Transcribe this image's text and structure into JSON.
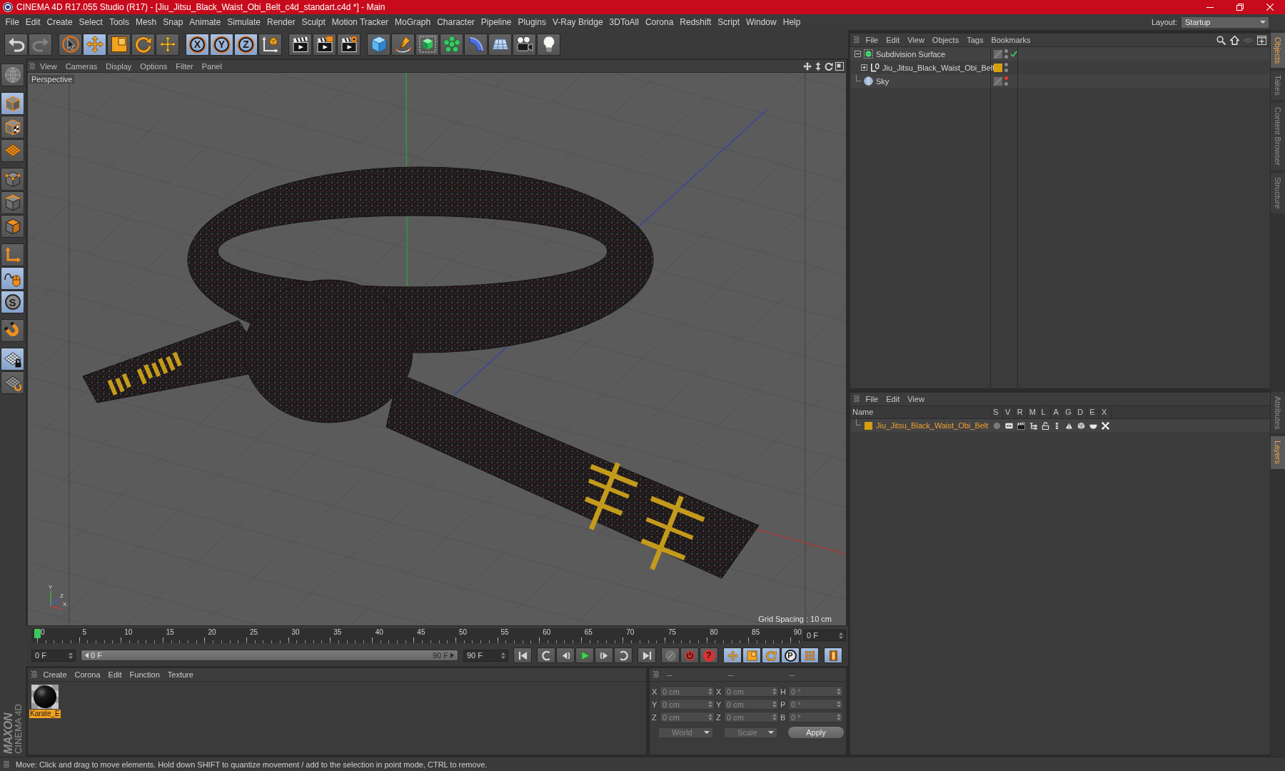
{
  "window": {
    "title": "CINEMA 4D R17.055 Studio (R17) - [Jiu_Jitsu_Black_Waist_Obi_Belt_c4d_standart.c4d *] - Main",
    "controls": [
      {
        "kind": "minimize"
      },
      {
        "kind": "restore"
      },
      {
        "kind": "close"
      }
    ]
  },
  "menu_bar": {
    "items": [
      "File",
      "Edit",
      "Create",
      "Select",
      "Tools",
      "Mesh",
      "Snap",
      "Animate",
      "Simulate",
      "Render",
      "Sculpt",
      "Motion Tracker",
      "MoGraph",
      "Character",
      "Pipeline",
      "Plugins",
      "V-Ray Bridge",
      "3DToAll",
      "Corona",
      "Redshift",
      "Script",
      "Window",
      "Help"
    ],
    "layout_label": "Layout:",
    "layout_value": "Startup"
  },
  "toolbar": {
    "groups": [
      [
        {
          "kind": "undo",
          "selected": false,
          "disabled": false
        },
        {
          "kind": "redo",
          "selected": false,
          "disabled": true
        }
      ],
      [
        {
          "kind": "live_select",
          "selected": false,
          "disabled": false
        },
        {
          "kind": "move",
          "selected": true,
          "disabled": false
        },
        {
          "kind": "scale",
          "selected": false,
          "disabled": false
        },
        {
          "kind": "rotate",
          "selected": false,
          "disabled": false
        },
        {
          "kind": "recent",
          "selected": false,
          "disabled": false
        }
      ],
      [
        {
          "kind": "axis_lock",
          "label": "X",
          "selected": true,
          "disabled": false
        },
        {
          "kind": "axis_lock",
          "label": "Y",
          "selected": true,
          "disabled": false
        },
        {
          "kind": "axis_lock",
          "label": "Z",
          "selected": true,
          "disabled": false
        },
        {
          "kind": "coordinate_system",
          "selected": false,
          "disabled": false
        }
      ],
      [
        {
          "kind": "render_view",
          "selected": false,
          "disabled": false
        },
        {
          "kind": "render_picture",
          "selected": false,
          "disabled": false
        },
        {
          "kind": "render_settings",
          "selected": false,
          "disabled": false
        }
      ],
      [
        {
          "kind": "cube",
          "selected": false,
          "disabled": false
        },
        {
          "kind": "pen",
          "selected": false,
          "disabled": false
        },
        {
          "kind": "subdivision",
          "selected": false,
          "disabled": false
        },
        {
          "kind": "cloner",
          "selected": false,
          "disabled": false
        },
        {
          "kind": "bend",
          "selected": false,
          "disabled": false
        },
        {
          "kind": "floor",
          "selected": false,
          "disabled": false
        },
        {
          "kind": "camera",
          "selected": false,
          "disabled": false
        },
        {
          "kind": "light",
          "selected": false,
          "disabled": false
        }
      ]
    ]
  },
  "side_tools": {
    "groups": [
      [
        {
          "kind": "make_editable",
          "selected": false
        }
      ],
      [
        {
          "kind": "model",
          "selected": true
        },
        {
          "kind": "texture",
          "selected": false
        },
        {
          "kind": "workplane",
          "selected": false
        }
      ],
      [
        {
          "kind": "points",
          "selected": false
        },
        {
          "kind": "edges",
          "selected": false
        },
        {
          "kind": "polygons",
          "selected": false
        }
      ],
      [
        {
          "kind": "axis",
          "selected": false
        },
        {
          "kind": "tweak",
          "selected": true
        },
        {
          "kind": "snap",
          "label": "S",
          "selected": true
        }
      ],
      [
        {
          "kind": "magnet",
          "selected": false
        }
      ],
      [
        {
          "kind": "workplane_lock",
          "selected": true
        },
        {
          "kind": "workplane_rotate",
          "selected": false
        }
      ]
    ]
  },
  "logo": {
    "brand": "MAXON",
    "product": "CINEMA 4D"
  },
  "viewport": {
    "menu": [
      "View",
      "Cameras",
      "Display",
      "Options",
      "Filter",
      "Panel"
    ],
    "camera_label": "Perspective",
    "grid_spacing": "Grid Spacing : 10 cm",
    "axis_labels": [
      "Y",
      "Z",
      "X"
    ]
  },
  "timeline": {
    "labels": [
      "0",
      "5",
      "10",
      "15",
      "20",
      "25",
      "30",
      "35",
      "40",
      "45",
      "50",
      "55",
      "60",
      "65",
      "70",
      "75",
      "80",
      "85",
      "90"
    ],
    "level": 0,
    "frame_field": "0 F"
  },
  "playback": {
    "start_field": "0 F",
    "range": {
      "start": "0 F",
      "end": "90 F",
      "level": 1
    },
    "end_field": "90 F",
    "groups": [
      [
        {
          "kind": "go_start",
          "selected": false
        }
      ],
      [
        {
          "kind": "prev_key",
          "selected": false
        },
        {
          "kind": "prev_frame",
          "selected": false
        },
        {
          "kind": "play",
          "selected": false
        },
        {
          "kind": "next_frame",
          "selected": false
        },
        {
          "kind": "next_key",
          "selected": false
        }
      ],
      [
        {
          "kind": "go_end",
          "selected": false
        }
      ],
      [
        {
          "kind": "record_objects",
          "selected": false
        },
        {
          "kind": "autokey",
          "selected": false
        },
        {
          "kind": "keyframe_selection",
          "label": "?",
          "selected": false
        }
      ],
      [
        {
          "kind": "key_position",
          "selected": true
        },
        {
          "kind": "key_scale",
          "selected": true
        },
        {
          "kind": "key_rotation",
          "selected": true
        },
        {
          "kind": "key_parameter",
          "label": "P",
          "selected": true
        },
        {
          "kind": "key_points",
          "selected": true
        }
      ],
      [
        {
          "kind": "timeline",
          "selected": true
        }
      ]
    ]
  },
  "material_manager": {
    "menu": [
      "Create",
      "Corona",
      "Edit",
      "Function",
      "Texture"
    ],
    "materials": [
      {
        "name": "Karate_E",
        "selected": true
      }
    ]
  },
  "coordinates": {
    "headers": [
      "--",
      "--",
      "--"
    ],
    "rows": [
      [
        {
          "axis": "X",
          "value": "0 cm"
        },
        {
          "axis": "X",
          "value": "0 cm"
        },
        {
          "axis": "H",
          "value": "0 °"
        }
      ],
      [
        {
          "axis": "Y",
          "value": "0 cm"
        },
        {
          "axis": "Y",
          "value": "0 cm"
        },
        {
          "axis": "P",
          "value": "0 °"
        }
      ],
      [
        {
          "axis": "Z",
          "value": "0 cm"
        },
        {
          "axis": "Z",
          "value": "0 cm"
        },
        {
          "axis": "B",
          "value": "0 °"
        }
      ]
    ],
    "dropdowns": [
      "World",
      "Scale"
    ],
    "apply_button": "Apply"
  },
  "object_manager": {
    "menu": [
      "File",
      "Edit",
      "View",
      "Objects",
      "Tags",
      "Bookmarks"
    ],
    "objects": [
      {
        "name": "Subdivision Surface",
        "kind": "subdivision",
        "expanded": true,
        "checkmark": true,
        "editor_hidden": false,
        "render_hidden": false,
        "children": [
          {
            "name": "Jiu_Jitsu_Black_Waist_Obi_Belt",
            "kind": "null",
            "expanded": false,
            "color": "#d89e12",
            "checkmark": false,
            "editor_hidden": false,
            "render_hidden": false
          }
        ]
      },
      {
        "name": "Sky",
        "kind": "sky",
        "checkmark": false,
        "editor_hidden": true,
        "render_hidden": false
      }
    ]
  },
  "layer_manager": {
    "menu": [
      "File",
      "Edit",
      "View"
    ],
    "columns": [
      "Name",
      "S",
      "V",
      "R",
      "M",
      "L",
      "A",
      "G",
      "D",
      "E",
      "X"
    ],
    "layers": [
      {
        "name": "Jiu_Jitsu_Black_Waist_Obi_Belt",
        "color": "#d89e12",
        "selected": true
      }
    ]
  },
  "side_tabs": {
    "top": [
      {
        "label": "Objects",
        "selected": true
      },
      {
        "label": "Takes",
        "selected": false
      },
      {
        "label": "Content Browser",
        "selected": false
      },
      {
        "label": "Structure",
        "selected": false
      }
    ],
    "bottom": [
      {
        "label": "Attributes",
        "selected": false
      },
      {
        "label": "Layers",
        "selected": true
      }
    ]
  },
  "status_bar": {
    "text": "Move: Click and drag to move elements. Hold down SHIFT to quantize movement / add to the selection in point mode, CTRL to remove."
  }
}
